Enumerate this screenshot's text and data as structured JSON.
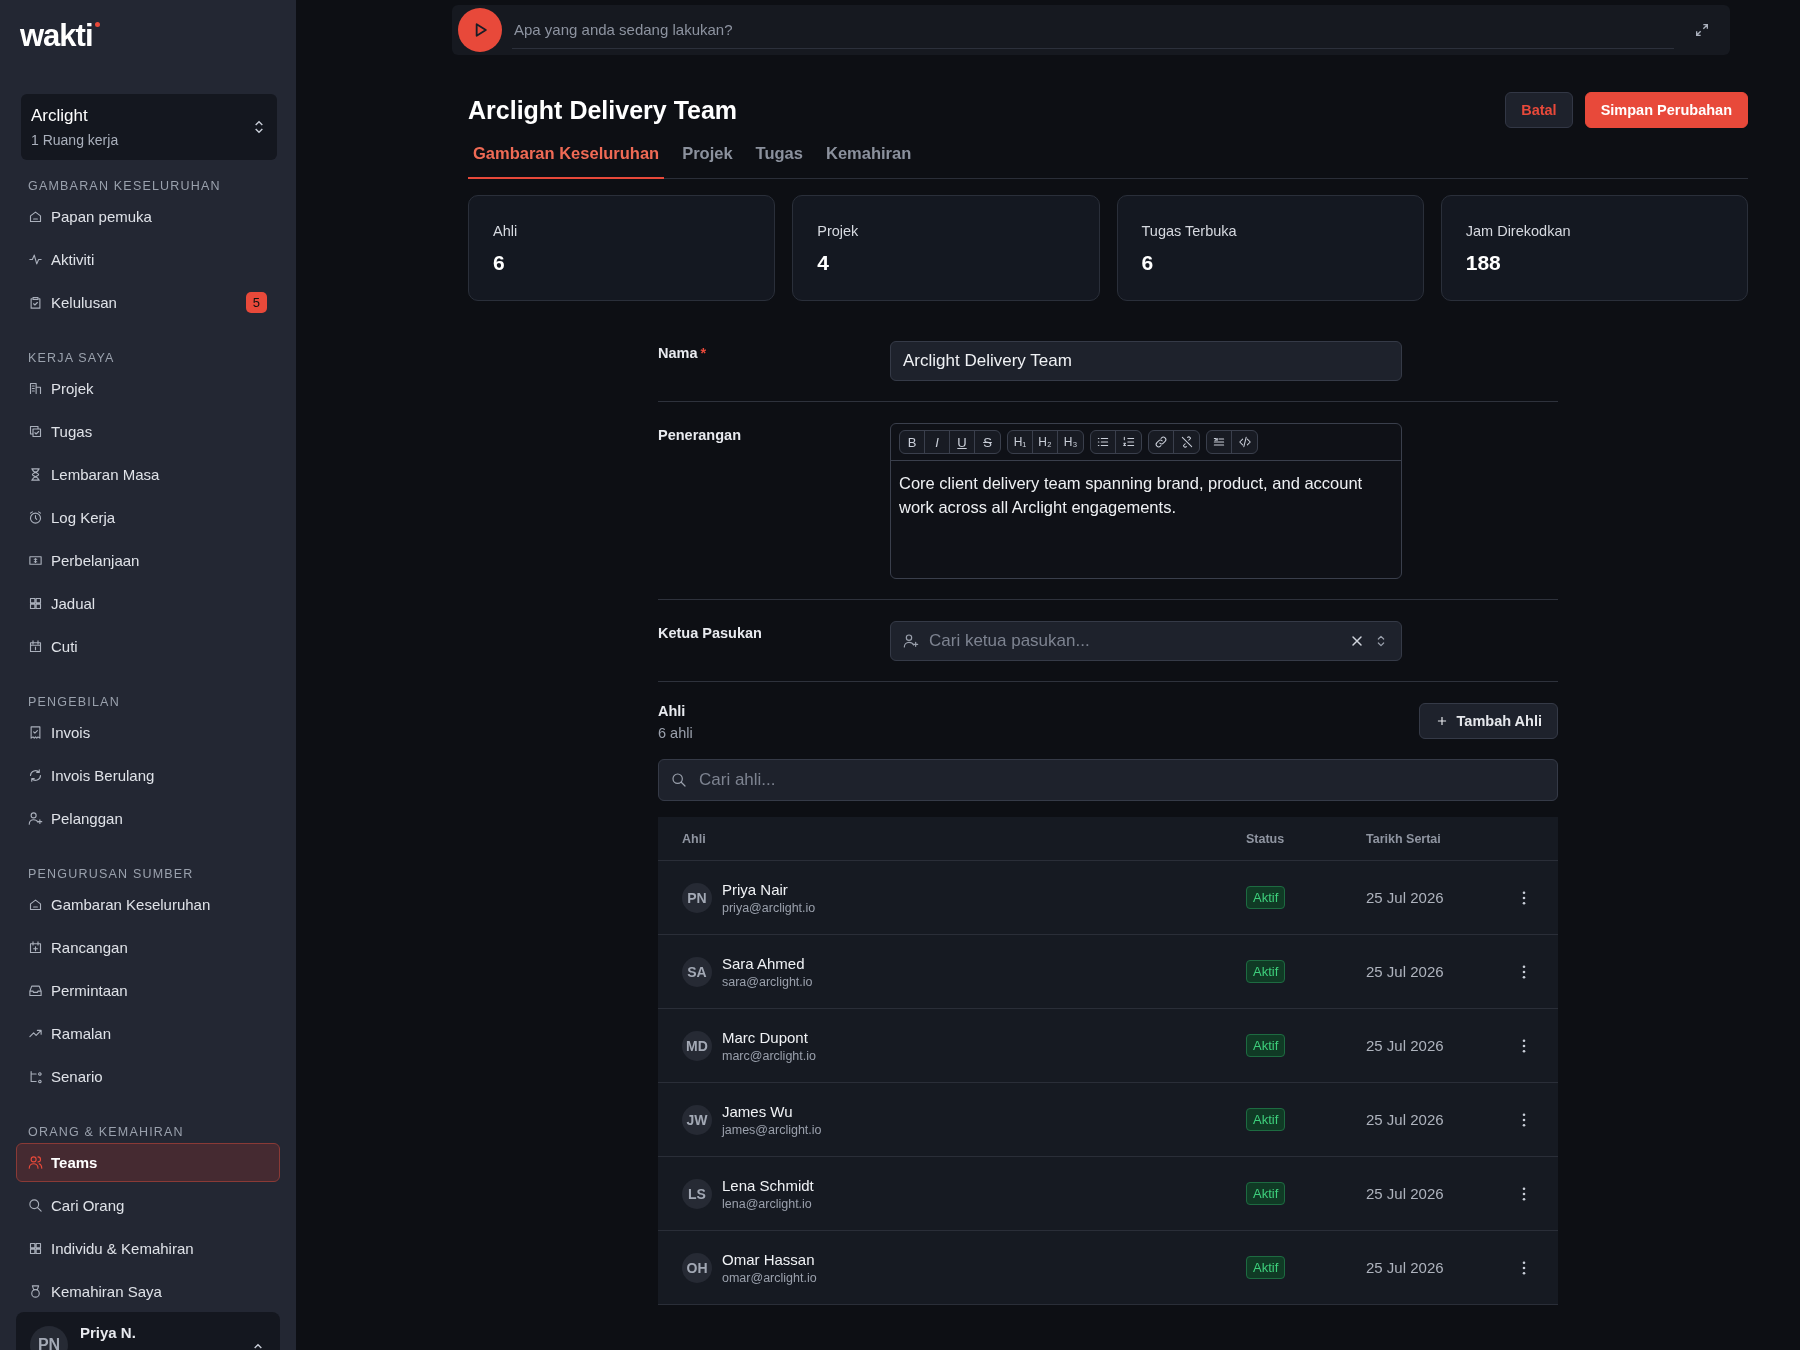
{
  "sidebar": {
    "logo": "wakti",
    "workspace": {
      "name": "Arclight",
      "subtitle": "1 Ruang kerja"
    },
    "sections": [
      {
        "title": "GAMBARAN KESELURUHAN",
        "items": [
          {
            "label": "Papan pemuka",
            "selected": false
          },
          {
            "label": "Aktiviti",
            "selected": false
          },
          {
            "label": "Kelulusan",
            "selected": false,
            "badge": "5"
          }
        ]
      },
      {
        "title": "KERJA SAYA",
        "items": [
          {
            "label": "Projek",
            "selected": false
          },
          {
            "label": "Tugas",
            "selected": false
          },
          {
            "label": "Lembaran Masa",
            "selected": false
          },
          {
            "label": "Log Kerja",
            "selected": false
          },
          {
            "label": "Perbelanjaan",
            "selected": false
          },
          {
            "label": "Jadual",
            "selected": false
          },
          {
            "label": "Cuti",
            "selected": false
          }
        ]
      },
      {
        "title": "PENGEBILAN",
        "items": [
          {
            "label": "Invois",
            "selected": false
          },
          {
            "label": "Invois Berulang",
            "selected": false
          },
          {
            "label": "Pelanggan",
            "selected": false
          }
        ]
      },
      {
        "title": "PENGURUSAN SUMBER",
        "items": [
          {
            "label": "Gambaran Keseluruhan",
            "selected": false
          },
          {
            "label": "Rancangan",
            "selected": false
          },
          {
            "label": "Permintaan",
            "selected": false
          },
          {
            "label": "Ramalan",
            "selected": false
          },
          {
            "label": "Senario",
            "selected": false
          }
        ]
      },
      {
        "title": "ORANG & KEMAHIRAN",
        "items": [
          {
            "label": "Teams",
            "selected": true
          },
          {
            "label": "Cari Orang",
            "selected": false
          },
          {
            "label": "Individu & Kemahiran",
            "selected": false
          },
          {
            "label": "Kemahiran Saya",
            "selected": false
          }
        ]
      }
    ],
    "user": {
      "initials": "PN",
      "name": "Priya N."
    }
  },
  "timer": {
    "placeholder": "Apa yang anda sedang lakukan?"
  },
  "page": {
    "title": "Arclight Delivery Team",
    "buttons": [
      {
        "label": "Batal",
        "kind": "secondary"
      },
      {
        "label": "Simpan Perubahan",
        "kind": "primary"
      }
    ]
  },
  "tabs": [
    {
      "label": "Gambaran Keseluruhan",
      "selected": true
    },
    {
      "label": "Projek",
      "selected": false
    },
    {
      "label": "Tugas",
      "selected": false
    },
    {
      "label": "Kemahiran",
      "selected": false
    }
  ],
  "stats": [
    {
      "label": "Ahli",
      "value": "6"
    },
    {
      "label": "Projek",
      "value": "4"
    },
    {
      "label": "Tugas Terbuka",
      "value": "6"
    },
    {
      "label": "Jam Direkodkan",
      "value": "188"
    }
  ],
  "form": {
    "name": {
      "label": "Nama",
      "required_mark": "*",
      "value": "Arclight Delivery Team"
    },
    "description": {
      "label": "Penerangan",
      "toolbar": [
        [
          "B",
          "I",
          "U",
          "S"
        ],
        [
          "H₁",
          "H₂",
          "H₃"
        ]
      ],
      "text": "Core client delivery team spanning brand, product, and account work across all Arclight engagements."
    },
    "leader": {
      "label": "Ketua Pasukan",
      "placeholder": "Cari ketua pasukan..."
    }
  },
  "members": {
    "title": "Ahli",
    "count": "6 ahli",
    "add_button": "Tambah Ahli",
    "search_placeholder": "Cari ahli...",
    "columns": [
      "Ahli",
      "Status",
      "Tarikh Sertai"
    ],
    "rows": [
      {
        "initials": "PN",
        "name": "Priya Nair",
        "email": "priya@arclight.io",
        "status": "Aktif",
        "joined": "25 Jul 2026"
      },
      {
        "initials": "SA",
        "name": "Sara Ahmed",
        "email": "sara@arclight.io",
        "status": "Aktif",
        "joined": "25 Jul 2026"
      },
      {
        "initials": "MD",
        "name": "Marc Dupont",
        "email": "marc@arclight.io",
        "status": "Aktif",
        "joined": "25 Jul 2026"
      },
      {
        "initials": "JW",
        "name": "James Wu",
        "email": "james@arclight.io",
        "status": "Aktif",
        "joined": "25 Jul 2026"
      },
      {
        "initials": "LS",
        "name": "Lena Schmidt",
        "email": "lena@arclight.io",
        "status": "Aktif",
        "joined": "25 Jul 2026"
      },
      {
        "initials": "OH",
        "name": "Omar Hassan",
        "email": "omar@arclight.io",
        "status": "Aktif",
        "joined": "25 Jul 2026"
      }
    ]
  }
}
